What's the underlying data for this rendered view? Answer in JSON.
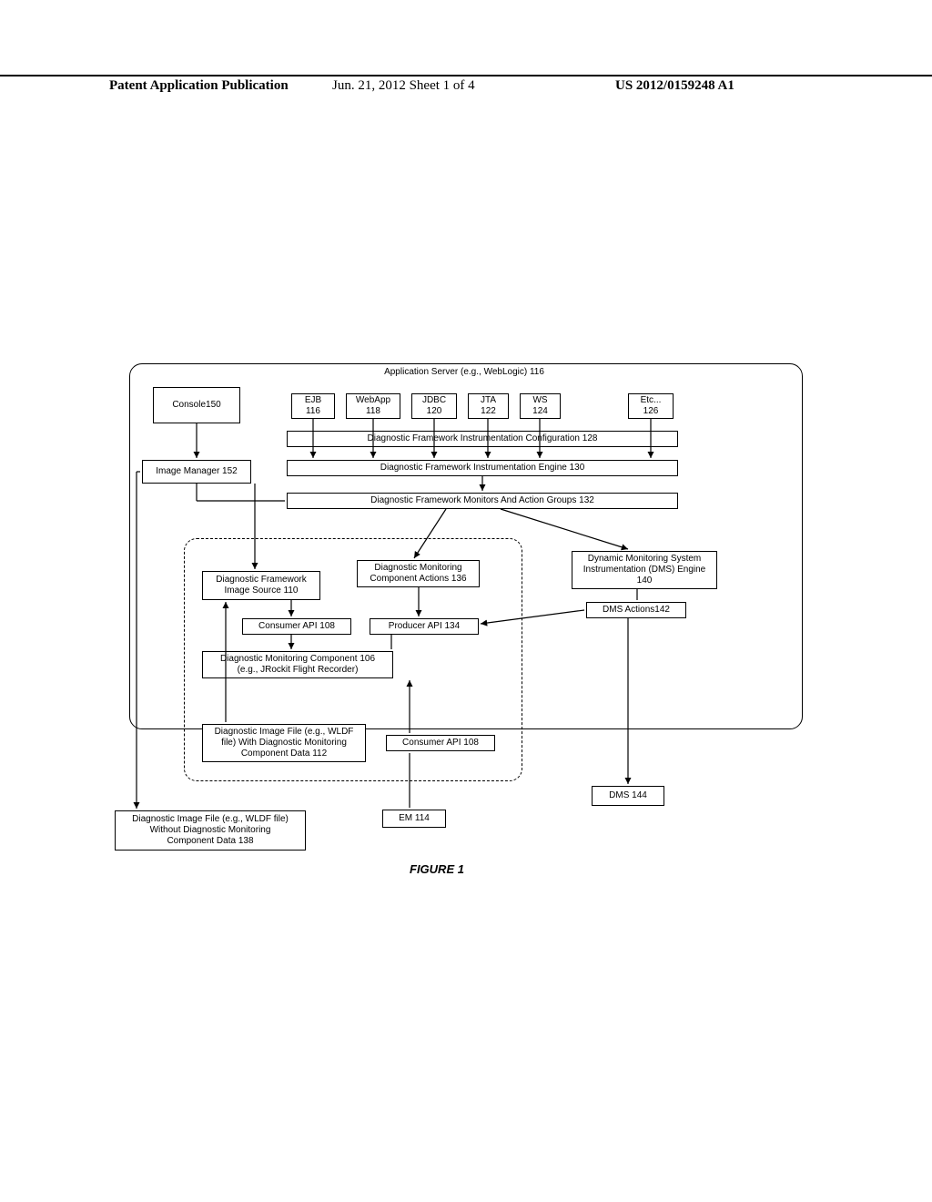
{
  "header": {
    "left": "Patent Application Publication",
    "middle": "Jun. 21, 2012  Sheet 1 of 4",
    "right": "US 2012/0159248 A1"
  },
  "server_title": "Application Server (e.g., WebLogic) 116",
  "top": {
    "console": "Console150",
    "ejb": "EJB\n116",
    "webapp": "WebApp\n118",
    "jdbc": "JDBC\n120",
    "jta": "JTA\n122",
    "ws": "WS\n124",
    "etc": "Etc...\n126"
  },
  "rows": {
    "config": "Diagnostic Framework Instrumentation Configuration 128",
    "engine": "Diagnostic Framework Instrumentation Engine 130",
    "monitors": "Diagnostic Framework Monitors And Action Groups 132",
    "image_manager": "Image Manager 152"
  },
  "mid": {
    "img_source": "Diagnostic Framework\nImage Source 110",
    "dmc_actions": "Diagnostic Monitoring\nComponent Actions 136",
    "consumer_api": "Consumer API 108",
    "producer_api": "Producer API 134",
    "dmc": "Diagnostic Monitoring Component 106\n(e.g., JRockit Flight Recorder)",
    "img_file_with": "Diagnostic Image File (e.g., WLDF\nfile) With Diagnostic Monitoring\nComponent Data 112",
    "consumer_api2": "Consumer API 108"
  },
  "right": {
    "dms_engine": "Dynamic Monitoring System\nInstrumentation (DMS) Engine\n140",
    "dms_actions": "DMS Actions142",
    "dms": "DMS 144"
  },
  "bottom": {
    "img_file_without": "Diagnostic Image File (e.g., WLDF file)\nWithout Diagnostic Monitoring\nComponent Data 138",
    "em": "EM 114"
  },
  "figure": "FIGURE 1"
}
